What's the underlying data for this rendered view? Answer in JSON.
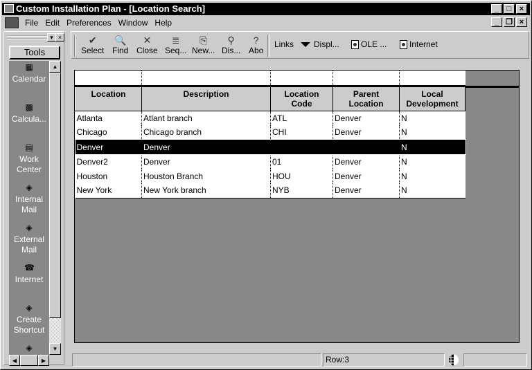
{
  "window": {
    "title": "Custom Installation Plan - [Location Search]",
    "controls": [
      "_",
      "□",
      "×"
    ]
  },
  "menubar": {
    "items": [
      {
        "label": "File"
      },
      {
        "label": "Edit"
      },
      {
        "label": "Preferences"
      },
      {
        "label": "Window"
      },
      {
        "label": "Help"
      }
    ],
    "mdi_controls": [
      "_",
      "❐",
      "×"
    ]
  },
  "sidebar": {
    "title": "Tools",
    "items": [
      {
        "label": "Calendar",
        "icon": "calendar-icon",
        "glyph": "▦"
      },
      {
        "label": "Calcula...",
        "icon": "calculator-icon",
        "glyph": "▩"
      },
      {
        "label": "Work Center",
        "icon": "work-center-icon",
        "glyph": "▤"
      },
      {
        "label": "Internal Mail",
        "icon": "mail-icon",
        "glyph": "◈"
      },
      {
        "label": "External Mail",
        "icon": "mail-icon",
        "glyph": "◈"
      },
      {
        "label": "Internet",
        "icon": "phone-icon",
        "glyph": "☎"
      },
      {
        "label": "Create Shortcut",
        "icon": "shortcut-icon",
        "glyph": "◈"
      }
    ]
  },
  "toolbar": {
    "buttons": [
      {
        "label": "Select",
        "icon": "check-icon",
        "glyph": "✔"
      },
      {
        "label": "Find",
        "icon": "find-icon",
        "glyph": "🔍"
      },
      {
        "label": "Close",
        "icon": "close-icon",
        "glyph": "✕"
      },
      {
        "label": "Seq...",
        "icon": "sequence-icon",
        "glyph": "≣"
      },
      {
        "label": "New...",
        "icon": "new-icon",
        "glyph": "⎘"
      },
      {
        "label": "Dis...",
        "icon": "display-icon",
        "glyph": "⚲"
      },
      {
        "label": "Abo",
        "icon": "about-icon",
        "glyph": "?"
      }
    ],
    "links_label": "Links",
    "links": [
      {
        "label": "Displ...",
        "icon": "dropdown-arrow-icon"
      },
      {
        "label": "OLE ...",
        "icon": "document-icon"
      },
      {
        "label": "Internet",
        "icon": "document-icon"
      }
    ]
  },
  "grid": {
    "columns": [
      "Location",
      "Description",
      "Location\nCode",
      "Parent\nLocation",
      "Local\nDevelopment"
    ],
    "rows": [
      [
        "Atlanta",
        "Atlant branch",
        "ATL",
        "Denver",
        "N"
      ],
      [
        "Chicago",
        "Chicago branch",
        "CHI",
        "Denver",
        "N"
      ],
      [
        "Denver",
        "Denver",
        "",
        "",
        "N"
      ],
      [
        "Denver2",
        "Denver",
        "01",
        "Denver",
        "N"
      ],
      [
        "Houston",
        "Houston Branch",
        "HOU",
        "Denver",
        "N"
      ],
      [
        "New York",
        "New York branch",
        "NYB",
        "Denver",
        "N"
      ]
    ],
    "selected_row": 2
  },
  "status": {
    "row_label": "Row:3"
  }
}
